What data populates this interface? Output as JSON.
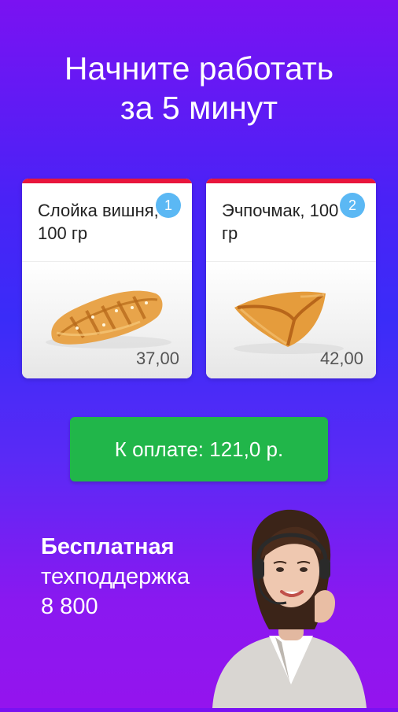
{
  "headline": {
    "line1": "Начните работать",
    "line2": "за 5 минут"
  },
  "products": [
    {
      "name": "Слойка вишня, 100 гр",
      "badge": "1",
      "price": "37,00",
      "image": "cherry-pastry"
    },
    {
      "name": "Эчпочмак, 100 гр",
      "badge": "2",
      "price": "42,00",
      "image": "echpochmak-pastry"
    }
  ],
  "pay_button": {
    "label": "К оплате: 121,0 р."
  },
  "support": {
    "title": "Бесплатная",
    "subtitle": "техподдержка",
    "phone": "8 800"
  },
  "colors": {
    "background_top": "#7a12f2",
    "background_mid": "#3a2cf8",
    "card_accent": "#e8163c",
    "badge": "#5bb8f4",
    "pay_button": "#21b64a"
  }
}
